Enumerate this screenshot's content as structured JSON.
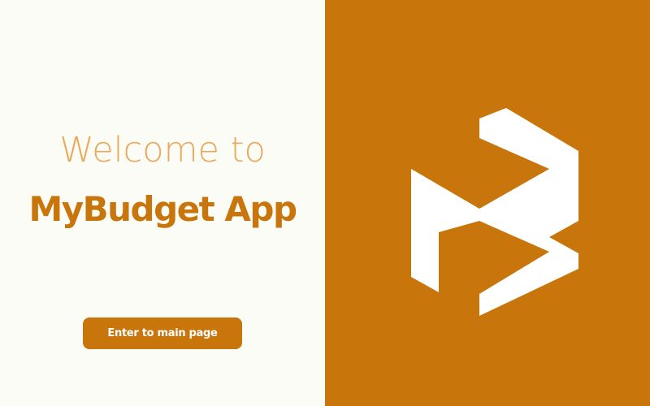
{
  "welcome": {
    "line1": "Welcome to",
    "line2": "MyBudget App"
  },
  "actions": {
    "enter_label": "Enter to main page"
  },
  "colors": {
    "brand": "#c8750c",
    "accent_light": "#eaa95a",
    "background_left": "#fcfcf7",
    "logo_fill": "#ffffff"
  },
  "logo": {
    "icon": "mybudget-logo-icon"
  }
}
